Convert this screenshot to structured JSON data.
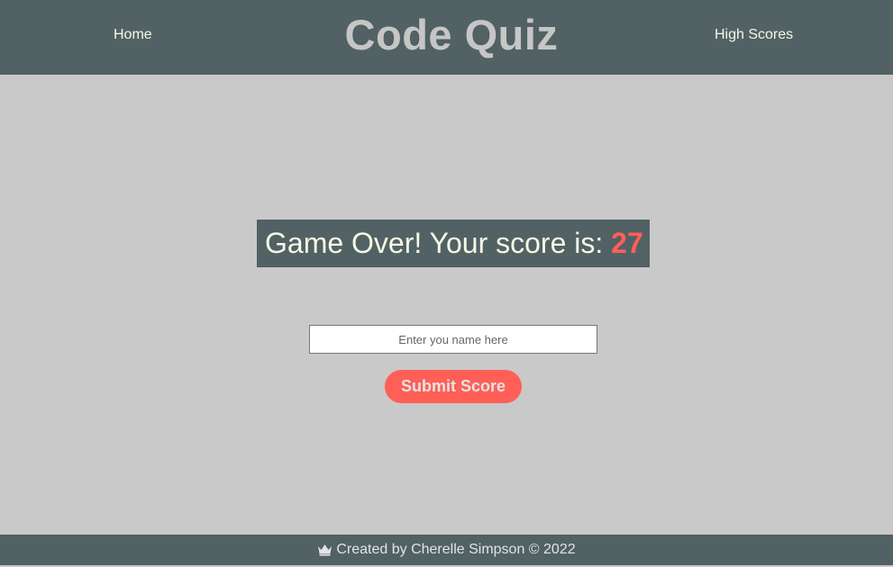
{
  "header": {
    "title": "Code Quiz",
    "nav_home": "Home",
    "nav_high_scores": "High Scores"
  },
  "result": {
    "message": "Game Over! Your score is: ",
    "score": "27"
  },
  "form": {
    "name_placeholder": "Enter you name here",
    "name_value": "",
    "submit_label": "Submit Score"
  },
  "footer": {
    "icon": "crown-icon",
    "credit": "Created by Cherelle Simpson © 2022"
  },
  "colors": {
    "header_bg": "#526163",
    "page_bg": "#c9c9c9",
    "accent": "#ff5f57",
    "nav_text": "#f5f8e6"
  }
}
